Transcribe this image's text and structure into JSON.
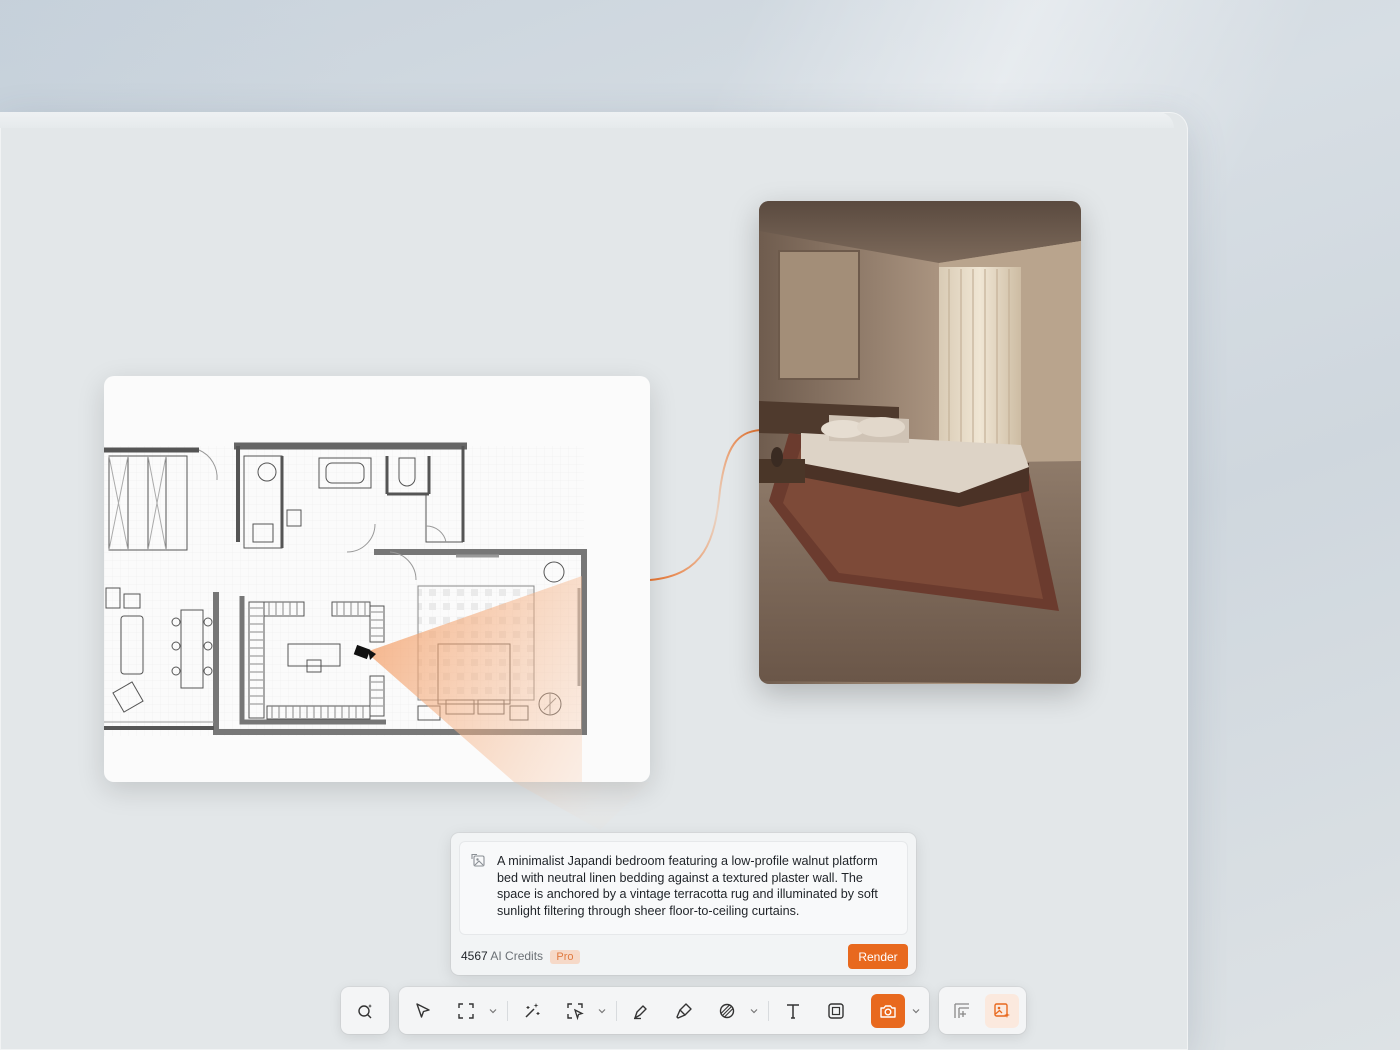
{
  "prompt": {
    "text": "A minimalist Japandi bedroom featuring a low-profile walnut platform bed with neutral linen bedding against a textured plaster wall. The space is anchored by a vintage terracotta rug and illuminated by soft sunlight filtering through sheer floor-to-ceiling curtains.",
    "credits_value": "4567",
    "credits_label": "AI Credits",
    "plan_badge": "Pro",
    "render_label": "Render"
  },
  "colors": {
    "accent": "#e8691e",
    "accent_soft": "#fbe9de",
    "canvas": "#e3e7e9",
    "panel": "#f2f4f5"
  },
  "toolbar": {
    "groups": [
      [
        "ai-search-icon"
      ],
      [
        "pointer-icon",
        "frame-select-icon",
        "magic-wand-icon",
        "smart-select-icon",
        "pen-icon",
        "brush-icon",
        "material-icon",
        "text-icon",
        "crop-icon",
        "camera-icon"
      ],
      [
        "layout-icon",
        "image-ai-icon"
      ]
    ],
    "active": "camera-icon"
  }
}
